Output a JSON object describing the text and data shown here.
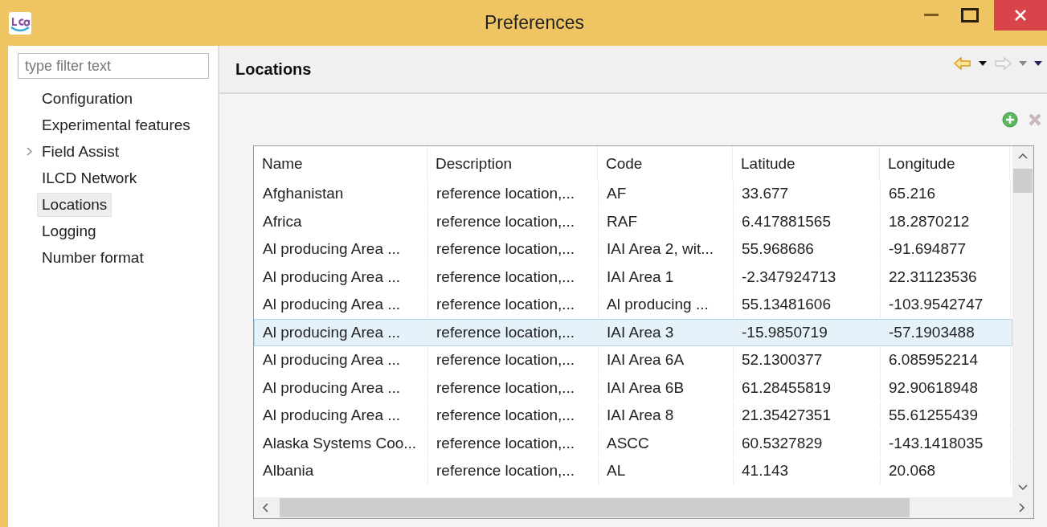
{
  "window": {
    "title": "Preferences"
  },
  "sidebar": {
    "filter": {
      "placeholder": "type filter text"
    },
    "items": [
      {
        "label": "Configuration",
        "expandable": false,
        "selected": false
      },
      {
        "label": "Experimental features",
        "expandable": false,
        "selected": false
      },
      {
        "label": "Field Assist",
        "expandable": true,
        "selected": false
      },
      {
        "label": "ILCD Network",
        "expandable": false,
        "selected": false
      },
      {
        "label": "Locations",
        "expandable": false,
        "selected": true
      },
      {
        "label": "Logging",
        "expandable": false,
        "selected": false
      },
      {
        "label": "Number format",
        "expandable": false,
        "selected": false
      }
    ]
  },
  "page": {
    "title": "Locations",
    "table": {
      "columns": [
        "Name",
        "Description",
        "Code",
        "Latitude",
        "Longitude"
      ],
      "rows": [
        {
          "cells": [
            "Afghanistan",
            "reference location,...",
            "AF",
            "33.677",
            "65.216"
          ],
          "selected": false
        },
        {
          "cells": [
            "Africa",
            "reference location,...",
            "RAF",
            "6.417881565",
            "18.2870212"
          ],
          "selected": false
        },
        {
          "cells": [
            "Al producing Area ...",
            "reference location,...",
            "IAI Area 2, wit...",
            "55.968686",
            "-91.694877"
          ],
          "selected": false
        },
        {
          "cells": [
            "Al producing Area ...",
            "reference location,...",
            "IAI Area 1",
            "-2.347924713",
            "22.31123536"
          ],
          "selected": false
        },
        {
          "cells": [
            "Al producing Area ...",
            "reference location,...",
            "Al producing ...",
            "55.13481606",
            "-103.9542747"
          ],
          "selected": false
        },
        {
          "cells": [
            "Al producing Area ...",
            "reference location,...",
            "IAI Area 3",
            "-15.9850719",
            "-57.1903488"
          ],
          "selected": true
        },
        {
          "cells": [
            "Al producing Area ...",
            "reference location,...",
            "IAI Area 6A",
            "52.1300377",
            "6.085952214"
          ],
          "selected": false
        },
        {
          "cells": [
            "Al producing Area ...",
            "reference location,...",
            "IAI Area 6B",
            "61.28455819",
            "92.90618948"
          ],
          "selected": false
        },
        {
          "cells": [
            "Al producing Area ...",
            "reference location,...",
            "IAI Area 8",
            "21.35427351",
            "55.61255439"
          ],
          "selected": false
        },
        {
          "cells": [
            "Alaska Systems Coo...",
            "reference location,...",
            "ASCC",
            "60.5327829",
            "-143.1418035"
          ],
          "selected": false
        },
        {
          "cells": [
            "Albania",
            "reference location,...",
            "AL",
            "41.143",
            "20.068"
          ],
          "selected": false
        }
      ]
    }
  }
}
